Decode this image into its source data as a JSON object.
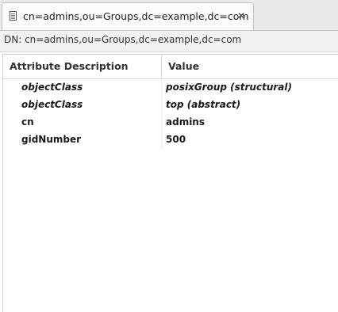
{
  "tab": {
    "title": "cn=admins,ou=Groups,dc=example,dc=com",
    "close_glyph": "✕",
    "icon": "entry-editor-icon"
  },
  "dn_bar": {
    "text": "DN: cn=admins,ou=Groups,dc=example,dc=com"
  },
  "table": {
    "columns": [
      "Attribute Description",
      "Value"
    ],
    "rows": [
      {
        "attribute": "objectClass",
        "value": "posixGroup (structural)",
        "italic": true
      },
      {
        "attribute": "objectClass",
        "value": "top (abstract)",
        "italic": true
      },
      {
        "attribute": "cn",
        "value": "admins",
        "italic": false
      },
      {
        "attribute": "gidNumber",
        "value": "500",
        "italic": false
      }
    ]
  }
}
